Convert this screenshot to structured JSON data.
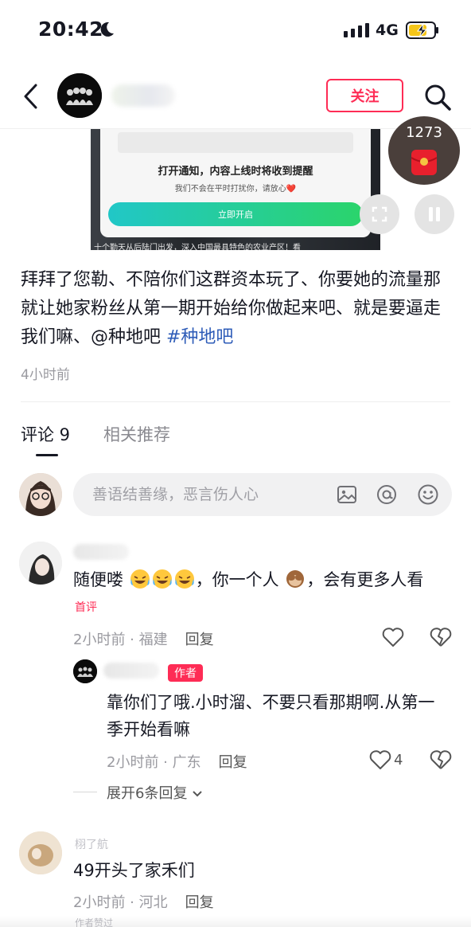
{
  "status": {
    "time": "20:42",
    "network": "4G"
  },
  "nav": {
    "follow_label": "关注"
  },
  "video": {
    "notice_title": "打开通知，内容上线时将收到提醒",
    "notice_sub": "我们不会在平时打扰你，请放心❤️",
    "notice_button": "立即开启",
    "caption": "十个勤天从后陆门出发，深入中国最具特色的农业产区！看"
  },
  "redpack": {
    "count": "1273"
  },
  "post": {
    "text": "拜拜了您勒、不陪你们这群资本玩了、你要她的流量那就让她家粉丝从第一期开始给你做起来吧、就是要逼走我们嘛、@种地吧 ",
    "hashtag": "#种地吧",
    "time": "4小时前"
  },
  "tabs": {
    "comments": "评论 9",
    "related": "相关推荐"
  },
  "comment_input": {
    "placeholder": "善语结善缘，恶言伤人心"
  },
  "comments": [
    {
      "text_a": "随便喽",
      "text_b": "，你一个人",
      "text_c": "，会有更多人看",
      "badge": "首评",
      "meta": "2小时前 · 福建",
      "reply": "回复"
    },
    {
      "badge": "作者",
      "text": "靠你们了哦.小时溜、不要只看那期啊.从第一季开始看嘛",
      "meta": "2小时前 · 广东",
      "reply": "回复",
      "likes": "4",
      "expand": "展开6条回复"
    },
    {
      "name": "栩了航",
      "text": "49开头了家禾们",
      "meta": "2小时前 · 河北",
      "reply": "回复"
    }
  ],
  "bottom_partial": "作者赞过"
}
